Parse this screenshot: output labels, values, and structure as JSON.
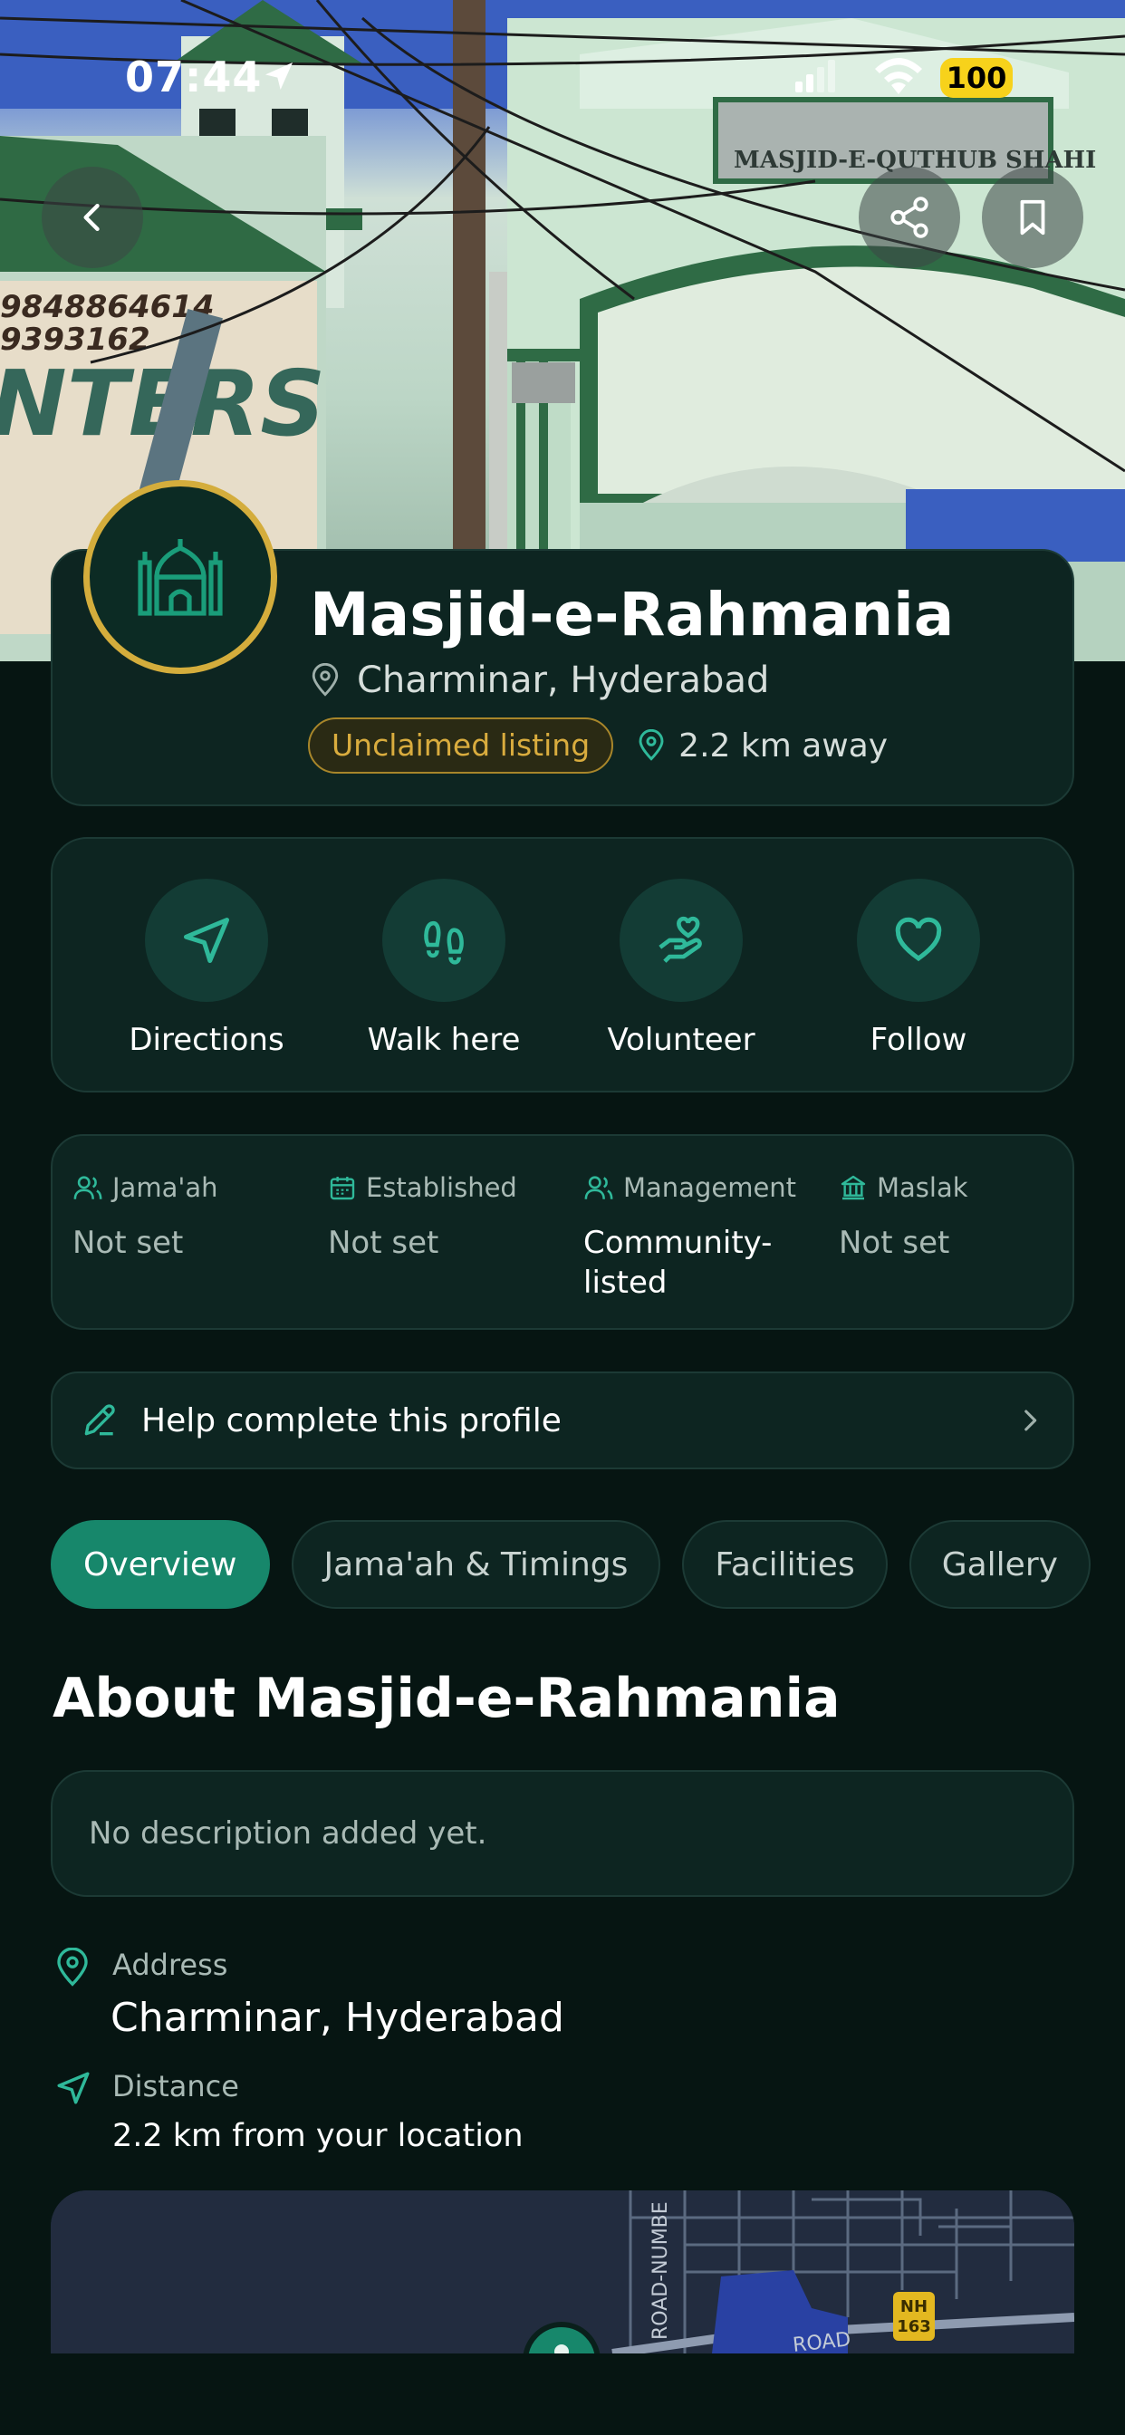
{
  "status_bar": {
    "time": "07:44",
    "battery": "100"
  },
  "header": {
    "title": "Masjid-e-Rahmania",
    "location": "Charminar, Hyderabad",
    "badge": "Unclaimed listing",
    "distance": "2.2 km away"
  },
  "hero_sign": {
    "text": "MASJID-E-QUTHUB SHAHI",
    "phone1": "9848864614",
    "phone2": "9393162"
  },
  "actions": [
    {
      "label": "Directions",
      "icon": "navigation-icon"
    },
    {
      "label": "Walk here",
      "icon": "footprints-icon"
    },
    {
      "label": "Volunteer",
      "icon": "hand-heart-icon"
    },
    {
      "label": "Follow",
      "icon": "heart-icon"
    }
  ],
  "info": [
    {
      "key": "Jama'ah",
      "value": "Not set",
      "icon": "users-icon"
    },
    {
      "key": "Established",
      "value": "Not set",
      "icon": "calendar-icon"
    },
    {
      "key": "Management",
      "value": "Community-listed",
      "icon": "users-icon"
    },
    {
      "key": "Maslak",
      "value": "Not set",
      "icon": "institution-icon"
    }
  ],
  "help": {
    "label": "Help complete this profile"
  },
  "tabs": [
    {
      "label": "Overview",
      "active": true
    },
    {
      "label": "Jama'ah & Timings",
      "active": false
    },
    {
      "label": "Facilities",
      "active": false
    },
    {
      "label": "Gallery",
      "active": false
    }
  ],
  "about": {
    "title": "About Masjid-e-Rahmania",
    "description": "No description added yet.",
    "address_label": "Address",
    "address": "Charminar, Hyderabad",
    "distance_label": "Distance",
    "distance": "2.2 km from your location"
  },
  "map": {
    "road_label_1": "ROAD-NUMBE",
    "road_label_2": "ROAD",
    "highway": "NH",
    "highway_num": "163"
  },
  "colors": {
    "accent": "#17876b",
    "gold": "#d4ad3c",
    "background": "#061512",
    "card": "#0d2521",
    "icon_teal": "#2fb99a"
  }
}
